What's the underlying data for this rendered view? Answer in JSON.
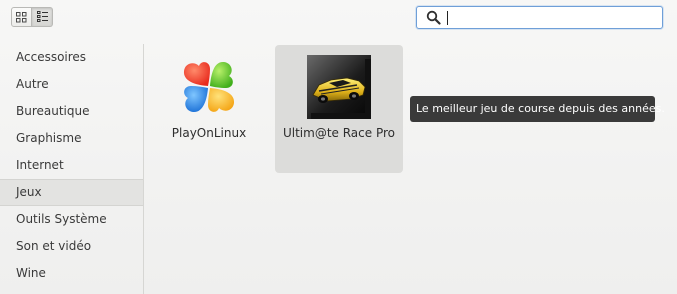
{
  "view_toggle": {
    "grid_icon": "grid-icon",
    "list_icon": "list-icon"
  },
  "search": {
    "value": "",
    "placeholder": "",
    "icon": "search-icon"
  },
  "sidebar": {
    "items": [
      {
        "label": "Accessoires"
      },
      {
        "label": "Autre"
      },
      {
        "label": "Bureautique"
      },
      {
        "label": "Graphisme"
      },
      {
        "label": "Internet"
      },
      {
        "label": "Jeux",
        "selected": true
      },
      {
        "label": "Outils Système"
      },
      {
        "label": "Son et vidéo"
      },
      {
        "label": "Wine"
      }
    ]
  },
  "apps": [
    {
      "label": "PlayOnLinux",
      "icon": "playonlinux-icon"
    },
    {
      "label": "Ultim@te Race Pro",
      "icon": "race-car-icon",
      "hovered": true
    }
  ],
  "tooltip": {
    "text": "Le meilleur jeu de course depuis des années."
  },
  "colors": {
    "tooltip_bg": "#3a3a3a",
    "selected_bg": "#e3e3e1",
    "focus_border": "#6f9fd8"
  }
}
